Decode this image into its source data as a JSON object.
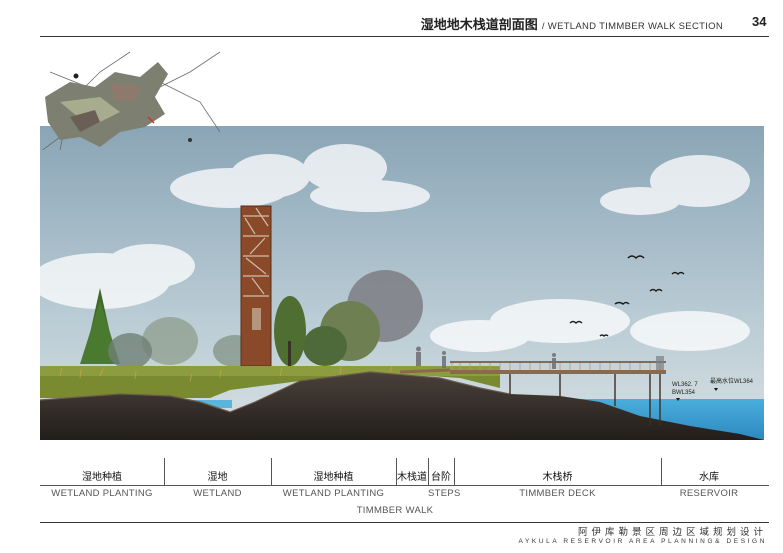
{
  "header": {
    "title_cn": "湿地地木栈道剖面图",
    "title_en": "/ WETLAND TIMMBER WALK SECTION",
    "page_number": "34"
  },
  "section": {
    "water_labels": {
      "wl": "WL362. 7",
      "bwl": "BWL354",
      "max_wl": "最高水位WL364"
    }
  },
  "zones": [
    {
      "cn": "湿地种植",
      "en": "WETLAND PLANTING"
    },
    {
      "cn": "湿地",
      "en": "WETLAND"
    },
    {
      "cn": "湿地种植",
      "en": "WETLAND PLANTING"
    },
    {
      "cn": "木栈道",
      "en": ""
    },
    {
      "cn": "台阶",
      "en": "STEPS"
    },
    {
      "cn": "木栈桥",
      "en": "TIMMBER DECK"
    },
    {
      "cn": "水库",
      "en": "RESERVOIR"
    }
  ],
  "sub_label": "TIMMBER WALK",
  "footer": {
    "project_cn": "阿伊库勒景区周边区域规划设计",
    "project_en": "AYKULA RESERVOIR AREA PLANNING& DESIGN"
  },
  "colors": {
    "sky_top": "#8fa9b8",
    "sky_bottom": "#c9d6dc",
    "soil": "#2f2a26",
    "water": "#3d9bd0",
    "tower": "#8a4a2a",
    "grass": "#7a8a30"
  }
}
